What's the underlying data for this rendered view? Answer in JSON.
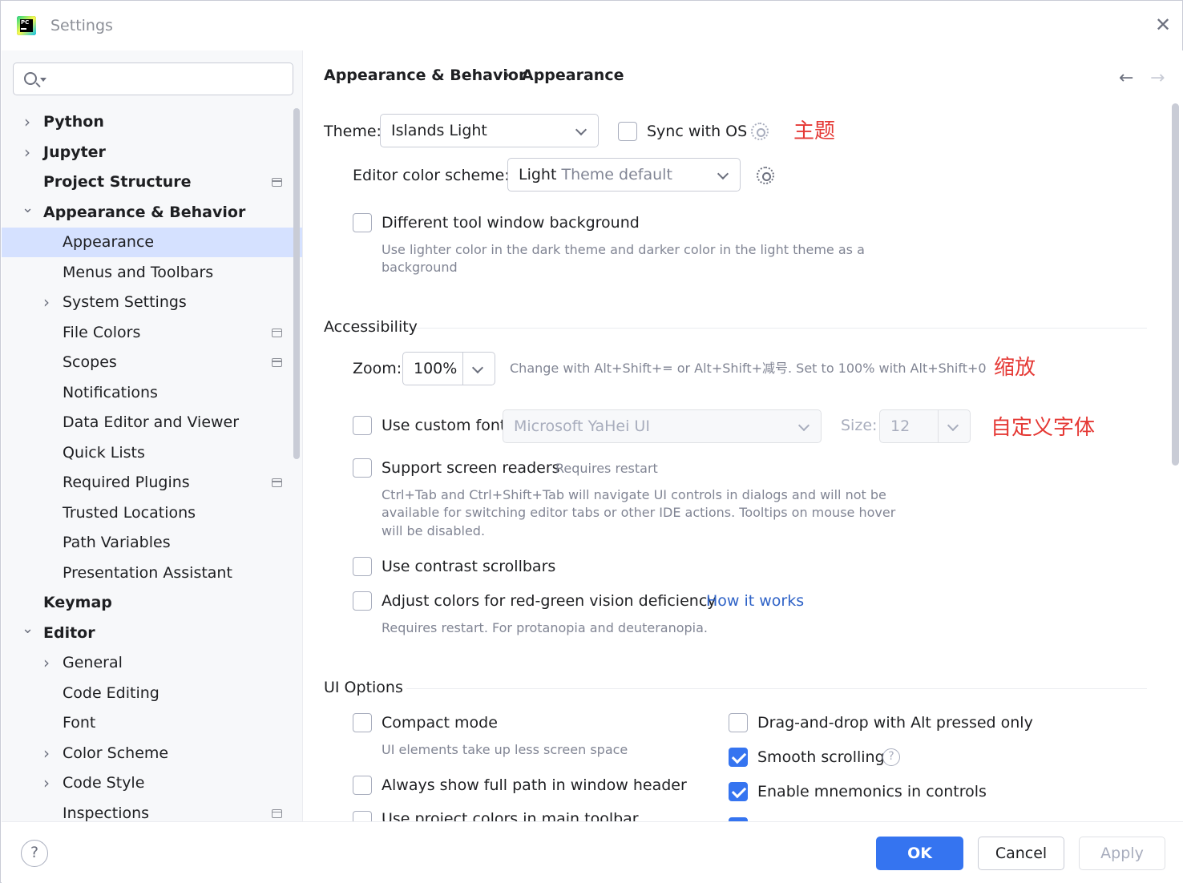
{
  "window": {
    "title": "Settings",
    "logo_text": "PC"
  },
  "search": {
    "placeholder": ""
  },
  "sidebar": {
    "items": [
      {
        "label": "Python",
        "bold": true,
        "chevron": "right",
        "indent": 0
      },
      {
        "label": "Jupyter",
        "bold": true,
        "chevron": "right",
        "indent": 0
      },
      {
        "label": "Project Structure",
        "bold": true,
        "chevron": "",
        "indent": 0,
        "project_icon": true
      },
      {
        "label": "Appearance & Behavior",
        "bold": true,
        "chevron": "down",
        "indent": 0
      },
      {
        "label": "Appearance",
        "bold": false,
        "chevron": "",
        "indent": 1,
        "selected": true
      },
      {
        "label": "Menus and Toolbars",
        "bold": false,
        "chevron": "",
        "indent": 1
      },
      {
        "label": "System Settings",
        "bold": false,
        "chevron": "right",
        "indent": 1
      },
      {
        "label": "File Colors",
        "bold": false,
        "chevron": "",
        "indent": 1,
        "project_icon": true
      },
      {
        "label": "Scopes",
        "bold": false,
        "chevron": "",
        "indent": 1,
        "project_icon": true
      },
      {
        "label": "Notifications",
        "bold": false,
        "chevron": "",
        "indent": 1
      },
      {
        "label": "Data Editor and Viewer",
        "bold": false,
        "chevron": "",
        "indent": 1
      },
      {
        "label": "Quick Lists",
        "bold": false,
        "chevron": "",
        "indent": 1
      },
      {
        "label": "Required Plugins",
        "bold": false,
        "chevron": "",
        "indent": 1,
        "project_icon": true
      },
      {
        "label": "Trusted Locations",
        "bold": false,
        "chevron": "",
        "indent": 1
      },
      {
        "label": "Path Variables",
        "bold": false,
        "chevron": "",
        "indent": 1
      },
      {
        "label": "Presentation Assistant",
        "bold": false,
        "chevron": "",
        "indent": 1
      },
      {
        "label": "Keymap",
        "bold": true,
        "chevron": "",
        "indent": 0
      },
      {
        "label": "Editor",
        "bold": true,
        "chevron": "down",
        "indent": 0
      },
      {
        "label": "General",
        "bold": false,
        "chevron": "right",
        "indent": 1
      },
      {
        "label": "Code Editing",
        "bold": false,
        "chevron": "",
        "indent": 1
      },
      {
        "label": "Font",
        "bold": false,
        "chevron": "",
        "indent": 1
      },
      {
        "label": "Color Scheme",
        "bold": false,
        "chevron": "right",
        "indent": 1
      },
      {
        "label": "Code Style",
        "bold": false,
        "chevron": "right",
        "indent": 1
      },
      {
        "label": "Inspections",
        "bold": false,
        "chevron": "",
        "indent": 1,
        "project_icon": true
      }
    ]
  },
  "breadcrumb": {
    "parent": "Appearance & Behavior",
    "separator": "›",
    "current": "Appearance"
  },
  "theme": {
    "label": "Theme:",
    "value": "Islands Light",
    "sync_label": "Sync with OS",
    "sync_checked": false,
    "annotation": "主题"
  },
  "editor_scheme": {
    "label": "Editor color scheme:",
    "value_main": "Light",
    "value_hint": " Theme default"
  },
  "tool_window_bg": {
    "label": "Different tool window background",
    "checked": false,
    "hint_line1": "Use lighter color in the dark theme and darker color in the light theme as a",
    "hint_line2": "background"
  },
  "accessibility": {
    "section_title": "Accessibility",
    "zoom_label": "Zoom:",
    "zoom_value": "100%",
    "zoom_hint": "Change with Alt+Shift+= or Alt+Shift+减号. Set to 100% with Alt+Shift+0",
    "zoom_annotation": "缩放",
    "custom_font_label": "Use custom font:",
    "custom_font_checked": false,
    "custom_font_value": "Microsoft YaHei UI",
    "size_label": "Size:",
    "size_value": "12",
    "font_annotation": "自定义字体",
    "screen_readers_label": "Support screen readers",
    "screen_readers_note": "Requires restart",
    "screen_readers_checked": false,
    "screen_readers_hint1": "Ctrl+Tab and Ctrl+Shift+Tab will navigate UI controls in dialogs and will not be",
    "screen_readers_hint2": "available for switching editor tabs or other IDE actions. Tooltips on mouse hover",
    "screen_readers_hint3": "will be disabled.",
    "contrast_label": "Use contrast scrollbars",
    "contrast_checked": false,
    "redgreen_label": "Adjust colors for red-green vision deficiency",
    "redgreen_checked": false,
    "redgreen_link": "How it works",
    "redgreen_hint": "Requires restart. For protanopia and deuteranopia."
  },
  "ui_options": {
    "section_title": "UI Options",
    "compact_label": "Compact mode",
    "compact_checked": false,
    "compact_hint": "UI elements take up less screen space",
    "full_path_label": "Always show full path in window header",
    "full_path_checked": false,
    "project_colors_label": "Use project colors in main toolbar",
    "dnd_label": "Drag-and-drop with Alt pressed only",
    "dnd_checked": false,
    "smooth_label": "Smooth scrolling",
    "smooth_checked": true,
    "mnemonics_label": "Enable mnemonics in controls",
    "mnemonics_checked": true
  },
  "footer": {
    "help": "?",
    "ok": "OK",
    "cancel": "Cancel",
    "apply": "Apply"
  },
  "colors": {
    "accent": "#3574f0",
    "selection": "#d5e1ff",
    "annotation": "#e53935",
    "link": "#2e62c7"
  }
}
